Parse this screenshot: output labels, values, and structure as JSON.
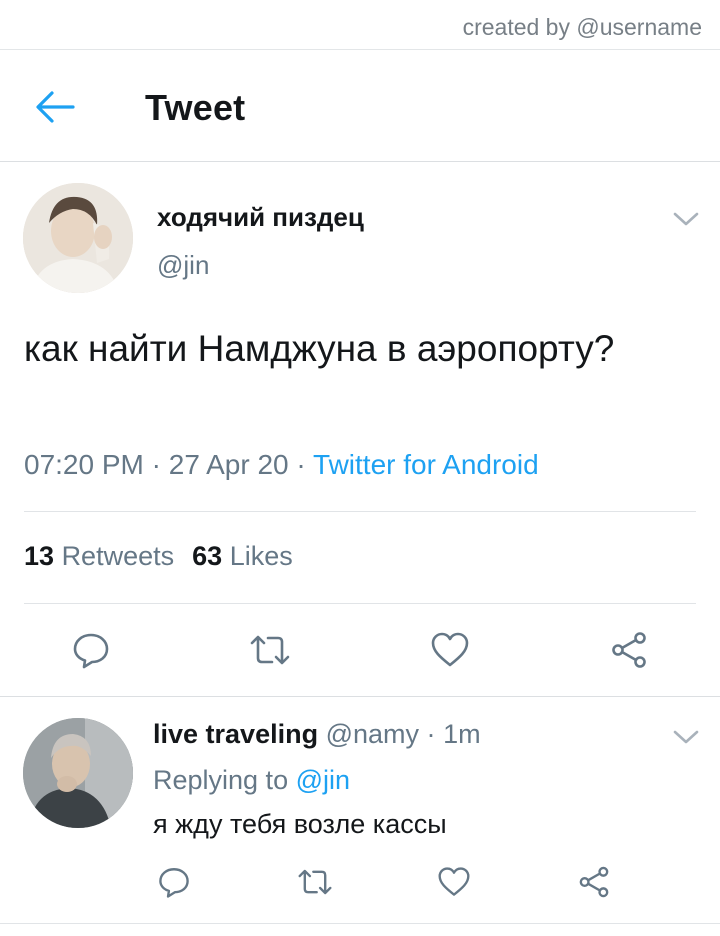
{
  "credit": "created by @username",
  "header": {
    "title": "Tweet"
  },
  "tweet": {
    "author_name": "ходячий пиздец",
    "author_handle": "@jin",
    "text": "как найти Намджуна в аэропорту?",
    "time": "07:20 PM",
    "date": "27 Apr 20",
    "source": "Twitter for Android",
    "separator": "·",
    "retweets_count": "13",
    "retweets_label": "Retweets",
    "likes_count": "63",
    "likes_label": "Likes"
  },
  "reply": {
    "author_name": "live traveling",
    "author_handle": "@namy",
    "separator": "·",
    "age": "1m",
    "replying_prefix": "Replying to",
    "replying_to": "@jin",
    "text": "я жду тебя возле кассы"
  },
  "icons": {
    "back": "arrow-left",
    "caret": "chevron-down",
    "reply": "speech-bubble",
    "retweet": "retweet-arrows",
    "like": "heart",
    "share": "share-nodes"
  },
  "colors": {
    "accent": "#1da1f2",
    "text_primary": "#14171a",
    "text_secondary": "#657786",
    "icon": "#657786",
    "divider": "#e1e4e7"
  }
}
